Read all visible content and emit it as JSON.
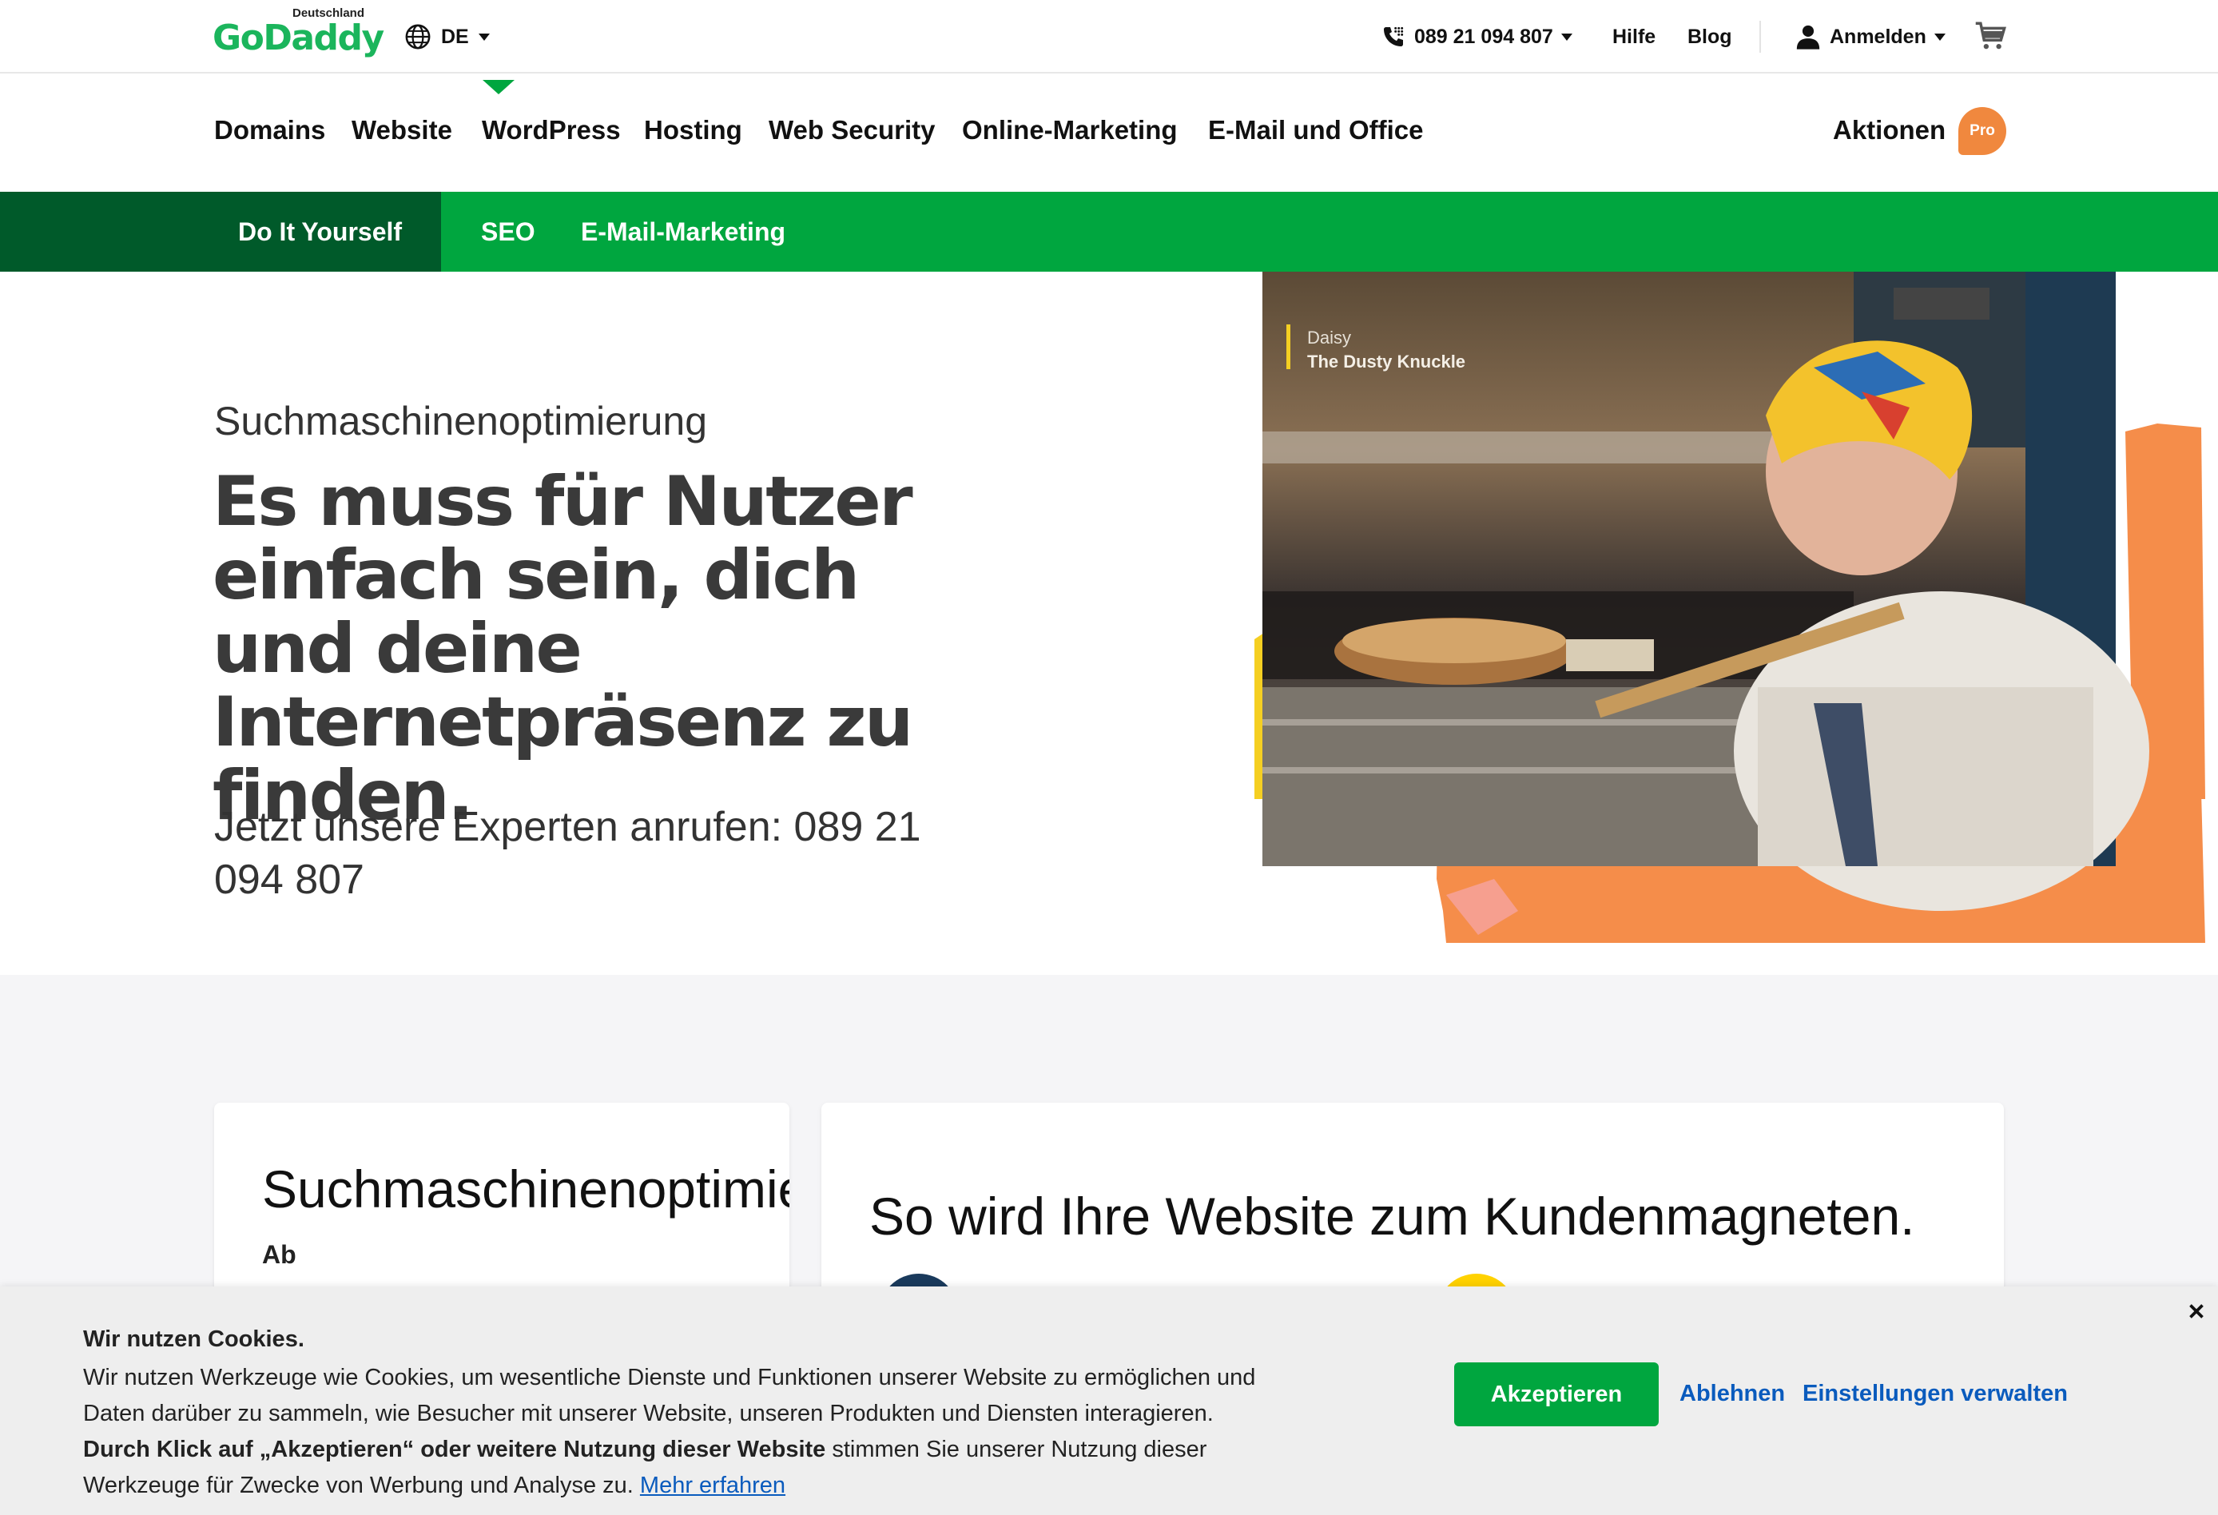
{
  "brand": {
    "logo_text": "GoDaddy",
    "logo_country": "Deutschland",
    "primary_color": "#1bb55c",
    "green": "#00a63f",
    "dark_green": "#005a2a",
    "orange": "#f0883e",
    "link_blue": "#0a5bbd"
  },
  "utility": {
    "language": "DE",
    "phone": "089 21 094 807",
    "help": "Hilfe",
    "blog": "Blog",
    "signin": "Anmelden"
  },
  "nav": {
    "items": [
      "Domains",
      "Website",
      "WordPress",
      "Hosting",
      "Web Security",
      "Online-Marketing",
      "E-Mail und Office"
    ],
    "promo": "Aktionen",
    "pro_badge": "Pro"
  },
  "subnav": {
    "items": [
      "Do It Yourself",
      "SEO",
      "E-Mail-Marketing"
    ],
    "active": "SEO"
  },
  "hero": {
    "eyebrow": "Suchmaschinenoptimierung",
    "title": "Es muss für Nutzer einfach sein, dich und deine Internetpräsenz zu finden.",
    "phone_cta": "Jetzt unsere Experten anrufen: 089 21 094 807",
    "image_caption_name": "Daisy",
    "image_caption_business": "The Dusty Knuckle"
  },
  "cards": {
    "card1_title": "Suchmaschinenoptimie",
    "card1_sub": "Ab",
    "card2_title": "So wird Ihre Website zum Kundenmagneten."
  },
  "cookie": {
    "title": "Wir nutzen Cookies.",
    "text1": "Wir nutzen Werkzeuge wie Cookies, um wesentliche Dienste und Funktionen unserer Website zu ermöglichen und Daten darüber zu sammeln, wie Besucher mit unserer Website, unseren Produkten und Diensten interagieren.",
    "text_bold": "Durch Klick auf „Akzeptieren“ oder weitere Nutzung dieser Website",
    "text2": " stimmen Sie unserer Nutzung dieser Werkzeuge für Zwecke von Werbung und Analyse zu. ",
    "learn_more": "Mehr erfahren",
    "accept": "Akzeptieren",
    "decline": "Ablehnen",
    "settings": "Einstellungen verwalten"
  }
}
